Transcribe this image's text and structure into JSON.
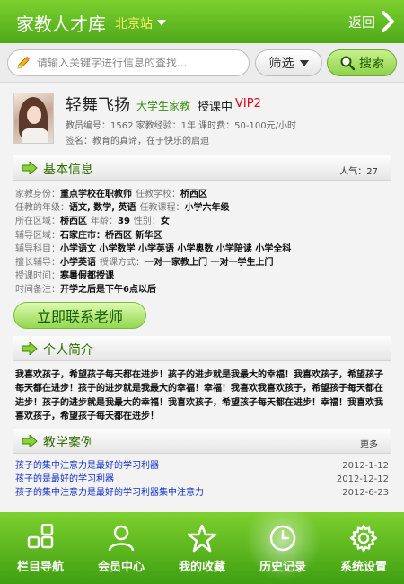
{
  "header": {
    "title": "家教人才库",
    "city": "北京站",
    "back_label": "返回"
  },
  "search": {
    "placeholder": "请输入关键字进行信息的查找...",
    "filter_label": "筛选",
    "search_label": "搜索"
  },
  "profile": {
    "name": "轻舞飞扬",
    "type": "大学生家教",
    "status": "授课中",
    "vip": "VIP2",
    "meta": "教员编号：1562  家教经验：1年  课时费：50-100元/小时",
    "signature": "签名：教育的真谛，在于快乐的启迪"
  },
  "basic_info": {
    "title": "基本信息",
    "popularity": "人气：27",
    "rows": [
      [
        {
          "k": "家教身份：",
          "v": "重点学校在职教师"
        },
        {
          "k": "任教学校：",
          "v": "桥西区"
        }
      ],
      [
        {
          "k": "任教的年级：",
          "v": "语文, 数学, 英语"
        },
        {
          "k": "任教课程：",
          "v": "小学六年级"
        }
      ],
      [
        {
          "k": "所在区域：",
          "v": "桥西区"
        },
        {
          "k": "年龄：",
          "v": "39"
        },
        {
          "k": "性别：",
          "v": "女"
        }
      ],
      [
        {
          "k": "辅导区域：",
          "v": "石家庄市：桥西区 新华区"
        }
      ],
      [
        {
          "k": "辅导科目：",
          "v": "小学语文 小学数学 小学英语 小学奥数 小学陪读 小学全科"
        }
      ],
      [
        {
          "k": "擅长辅导：",
          "v": "小学英语"
        },
        {
          "k": "授课方式：",
          "v": "一对一家教上门 一对一学生上门"
        }
      ],
      [
        {
          "k": "授课时间：",
          "v": "寒暑假都授课"
        }
      ],
      [
        {
          "k": "时间备注：",
          "v": "开学之后是下午6点以后"
        }
      ]
    ]
  },
  "contact_button": "立即联系老师",
  "bio": {
    "title": "个人简介",
    "text": "我喜欢孩子，希望孩子每天都在进步！孩子的进步就是我最大的幸福！我喜欢孩子，希望孩子每天都在进步！孩子的进步就是我最大的幸福！幸福！我喜欢我喜欢孩子，希望孩子每天都在进步！孩子的进步就是我最大的幸福！我喜欢孩子，希望孩子每天都在进步！幸福！我喜欢我喜欢孩子，希望孩子每天都在进步！"
  },
  "cases": {
    "title": "教学案例",
    "more_label": "更多",
    "items": [
      {
        "title": "孩子的集中注意力是最好的学习利器",
        "date": "2012-1-12"
      },
      {
        "title": "孩子的是最好的学习利器",
        "date": "2012-12-12"
      },
      {
        "title": "孩子的集中注意力是最好的学习利器集中注意力",
        "date": "2012-6-23"
      }
    ]
  },
  "nav": {
    "items": [
      {
        "label": "栏目导航",
        "icon": "grid-icon"
      },
      {
        "label": "会员中心",
        "icon": "user-icon"
      },
      {
        "label": "我的收藏",
        "icon": "star-icon"
      },
      {
        "label": "历史记录",
        "icon": "clock-icon",
        "active": true
      },
      {
        "label": "系统设置",
        "icon": "gear-icon"
      }
    ]
  },
  "colors": {
    "accent_green": "#4ea81a",
    "vip_red": "#e60012",
    "link_blue": "#1230c8",
    "city_yellow": "#fff36a"
  }
}
